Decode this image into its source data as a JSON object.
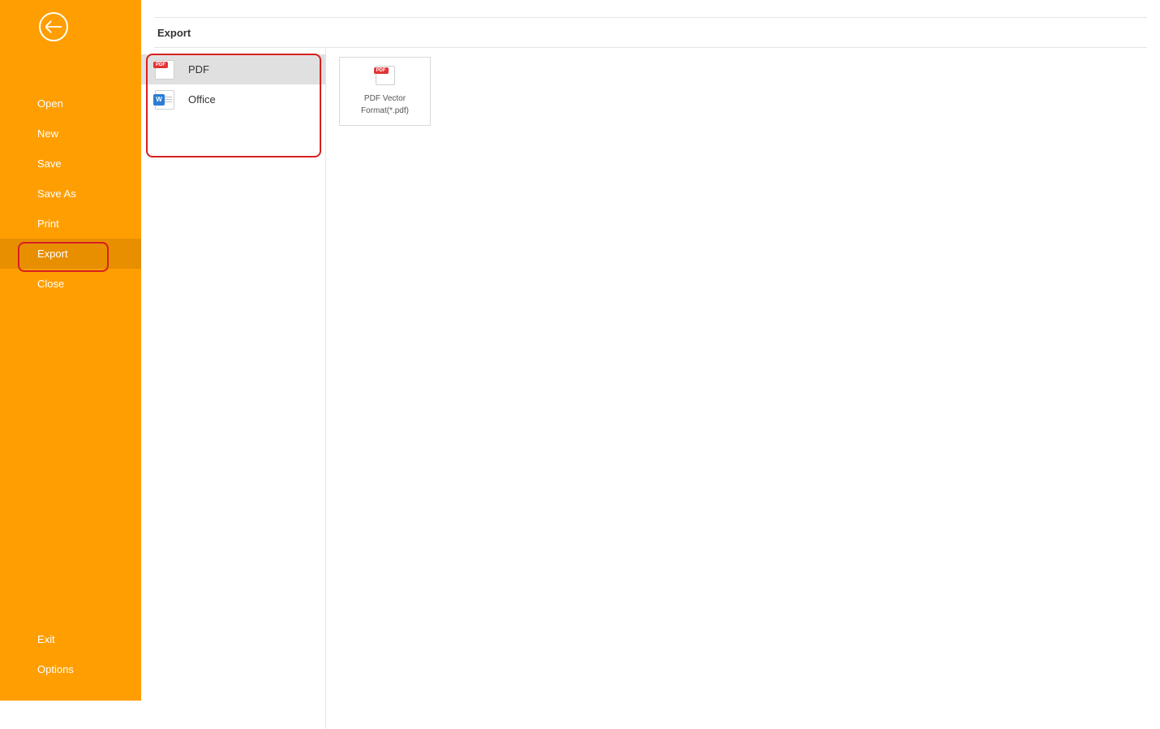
{
  "sidebar": {
    "items": [
      {
        "label": "Open"
      },
      {
        "label": "New"
      },
      {
        "label": "Save"
      },
      {
        "label": "Save As"
      },
      {
        "label": "Print"
      },
      {
        "label": "Export"
      },
      {
        "label": "Close"
      }
    ],
    "bottom": [
      {
        "label": "Exit"
      },
      {
        "label": "Options"
      }
    ]
  },
  "header": {
    "title": "Export"
  },
  "formats": [
    {
      "label": "PDF",
      "icon_badge": "PDF"
    },
    {
      "label": "Office",
      "icon_badge": "W"
    }
  ],
  "output": {
    "label_line1": "PDF Vector",
    "label_line2": "Format(*.pdf)",
    "icon_badge": "PDF"
  }
}
